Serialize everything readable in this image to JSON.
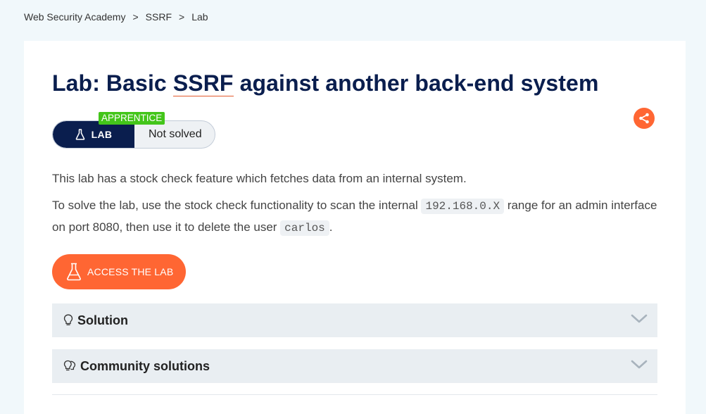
{
  "breadcrumb": {
    "items": [
      "Web Security Academy",
      "SSRF",
      "Lab"
    ],
    "separator": ">"
  },
  "lab": {
    "title_prefix": "Lab: Basic ",
    "title_link": "SSRF",
    "title_suffix": " against another back-end system",
    "level": "APPRENTICE",
    "type_label": "LAB",
    "status": "Not solved",
    "description": {
      "p1": "This lab has a stock check feature which fetches data from an internal system.",
      "p2_a": "To solve the lab, use the stock check functionality to scan the internal ",
      "p2_code1": "192.168.0.X",
      "p2_b": " range for an admin interface on port 8080, then use it to delete the user ",
      "p2_code2": "carlos",
      "p2_c": "."
    },
    "access_button": "ACCESS THE LAB"
  },
  "sections": {
    "solution": "Solution",
    "community": "Community solutions"
  },
  "icons": {
    "share": "share-icon",
    "flask": "flask-icon",
    "lightbulb": "lightbulb-icon",
    "chevron": "chevron-down-icon"
  },
  "colors": {
    "accent": "#ff6633",
    "navy": "#0a1e4e",
    "level_green": "#43c51a",
    "background": "#f1f8fb"
  }
}
